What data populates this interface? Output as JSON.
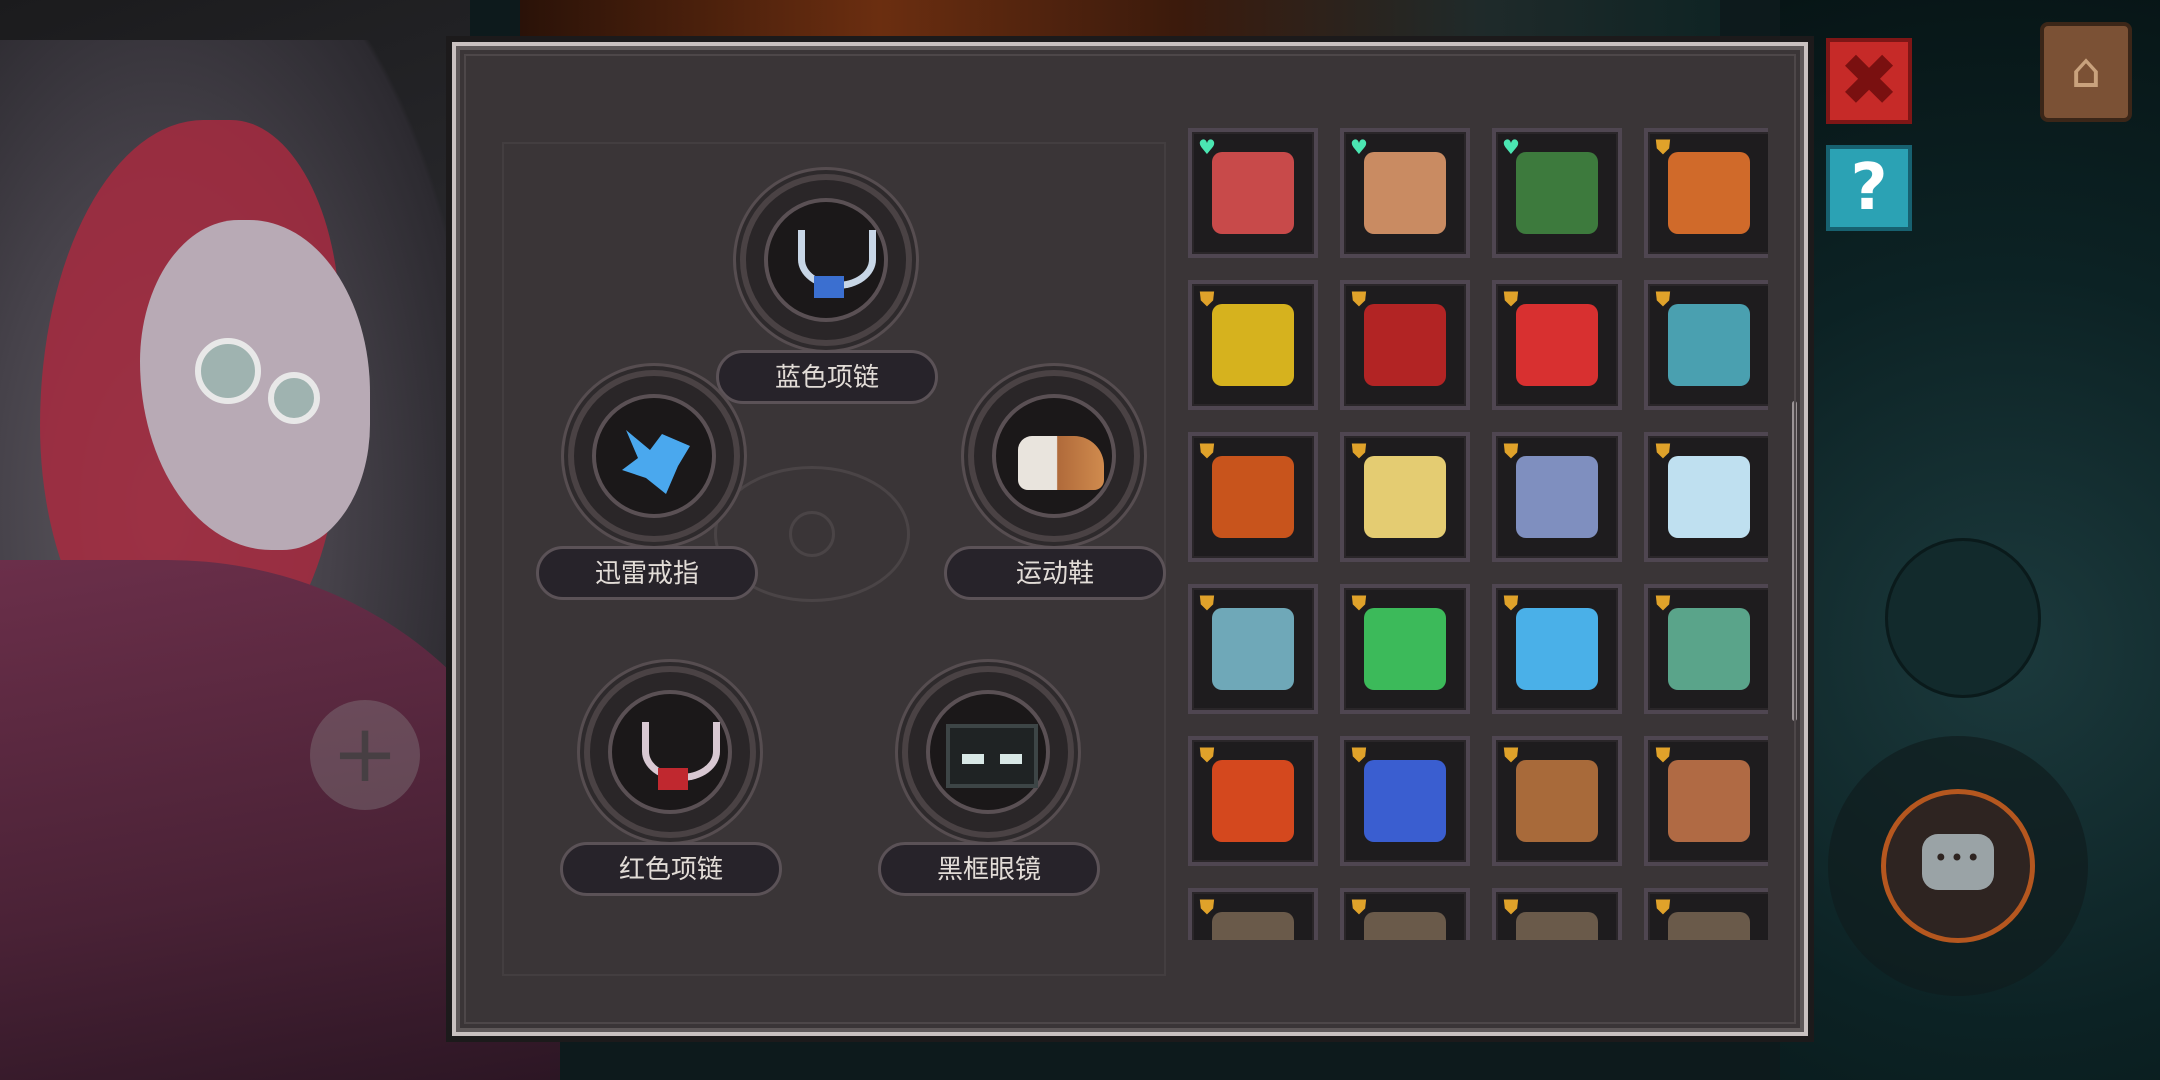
{
  "equipment": {
    "slots": [
      {
        "id": "top",
        "label": "蓝色项链",
        "icon": "blue-necklace-icon"
      },
      {
        "id": "left",
        "label": "迅雷戒指",
        "icon": "blue-bird-ring-icon"
      },
      {
        "id": "right",
        "label": "运动鞋",
        "icon": "sneaker-icon"
      },
      {
        "id": "bottom-left",
        "label": "红色项链",
        "icon": "red-necklace-icon"
      },
      {
        "id": "bottom-right",
        "label": "黑框眼镜",
        "icon": "black-glasses-icon"
      }
    ]
  },
  "inventory": {
    "rows": [
      [
        {
          "icon": "red-meat-club-icon",
          "badge": "heart",
          "color": "#c84a4a"
        },
        {
          "icon": "nerd-face-icon",
          "badge": "heart",
          "color": "#c98b62"
        },
        {
          "icon": "green-shovel-icon",
          "badge": "heart",
          "color": "#3d7a3d"
        },
        {
          "icon": "orange-vest-icon",
          "badge": "shield",
          "color": "#d06a2a"
        }
      ],
      [
        {
          "icon": "golden-armor-icon",
          "badge": "shield",
          "color": "#d6b21e"
        },
        {
          "icon": "red-eye-shield-icon",
          "badge": "shield",
          "color": "#b22424"
        },
        {
          "icon": "red-potion-icon",
          "badge": "shield",
          "color": "#d83030"
        },
        {
          "icon": "teal-boot-icon",
          "badge": "shield",
          "color": "#4aa0b0"
        }
      ],
      [
        {
          "icon": "lava-chunks-icon",
          "badge": "shield",
          "color": "#c8541c"
        },
        {
          "icon": "golden-chest-icon",
          "badge": "shield",
          "color": "#e4cc72"
        },
        {
          "icon": "blue-cloak-icon",
          "badge": "shield",
          "color": "#7f8fbf"
        },
        {
          "icon": "ice-crystal-icon",
          "badge": "shield",
          "color": "#bfe0f0"
        }
      ],
      [
        {
          "icon": "frost-star-icon",
          "badge": "shield",
          "color": "#6fa8b8"
        },
        {
          "icon": "green-rune-scroll-icon",
          "badge": "shield",
          "color": "#3cba5a"
        },
        {
          "icon": "lightning-scroll-icon",
          "badge": "shield",
          "color": "#4ab0e8"
        },
        {
          "icon": "green-snake-icon",
          "badge": "shield",
          "color": "#5aa48a"
        }
      ],
      [
        {
          "icon": "fire-scroll-icon",
          "badge": "shield",
          "color": "#d4481e"
        },
        {
          "icon": "water-scroll-icon",
          "badge": "shield",
          "color": "#3a5ed0"
        },
        {
          "icon": "wooden-cane-icon",
          "badge": "shield",
          "color": "#a86a3a"
        },
        {
          "icon": "brown-boot-icon",
          "badge": "shield",
          "color": "#b06a44"
        }
      ],
      [
        {
          "icon": "partial-item-icon",
          "badge": "shield",
          "color": "#6a5a4a"
        },
        {
          "icon": "partial-item-icon",
          "badge": "shield",
          "color": "#6a5a4a"
        },
        {
          "icon": "partial-item-icon",
          "badge": "shield",
          "color": "#6a5a4a"
        },
        {
          "icon": "partial-item-icon",
          "badge": "shield",
          "color": "#6a5a4a"
        }
      ]
    ]
  },
  "controls": {
    "close_glyph": "✖",
    "help_glyph": "?",
    "add_glyph": "+"
  },
  "colors": {
    "panel_bg": "#3a3537",
    "panel_border": "#c9c1c0",
    "close_button": "#c62a28",
    "help_button": "#2ba2b4",
    "heart_badge": "#4be6b2",
    "shield_badge": "#e0a22a",
    "chat_ring": "#b5571f"
  }
}
